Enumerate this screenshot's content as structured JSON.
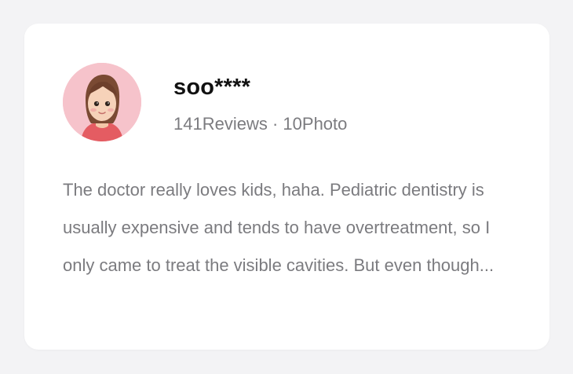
{
  "review": {
    "avatar_icon": "user-avatar-icon",
    "username": "soo****",
    "reviews_count": "141Reviews",
    "separator": "·",
    "photos_count": "10Photo",
    "text": "The doctor really loves kids, haha. Pediatric dentistry is usually expensive and tends to have overtreatment, so I only came to treat the visible cavities. But even though..."
  },
  "colors": {
    "page_background": "#f3f3f5",
    "card_background": "#ffffff",
    "avatar_background": "#f6c3cb",
    "username": "#111111",
    "secondary_text": "#7b7b7f"
  }
}
